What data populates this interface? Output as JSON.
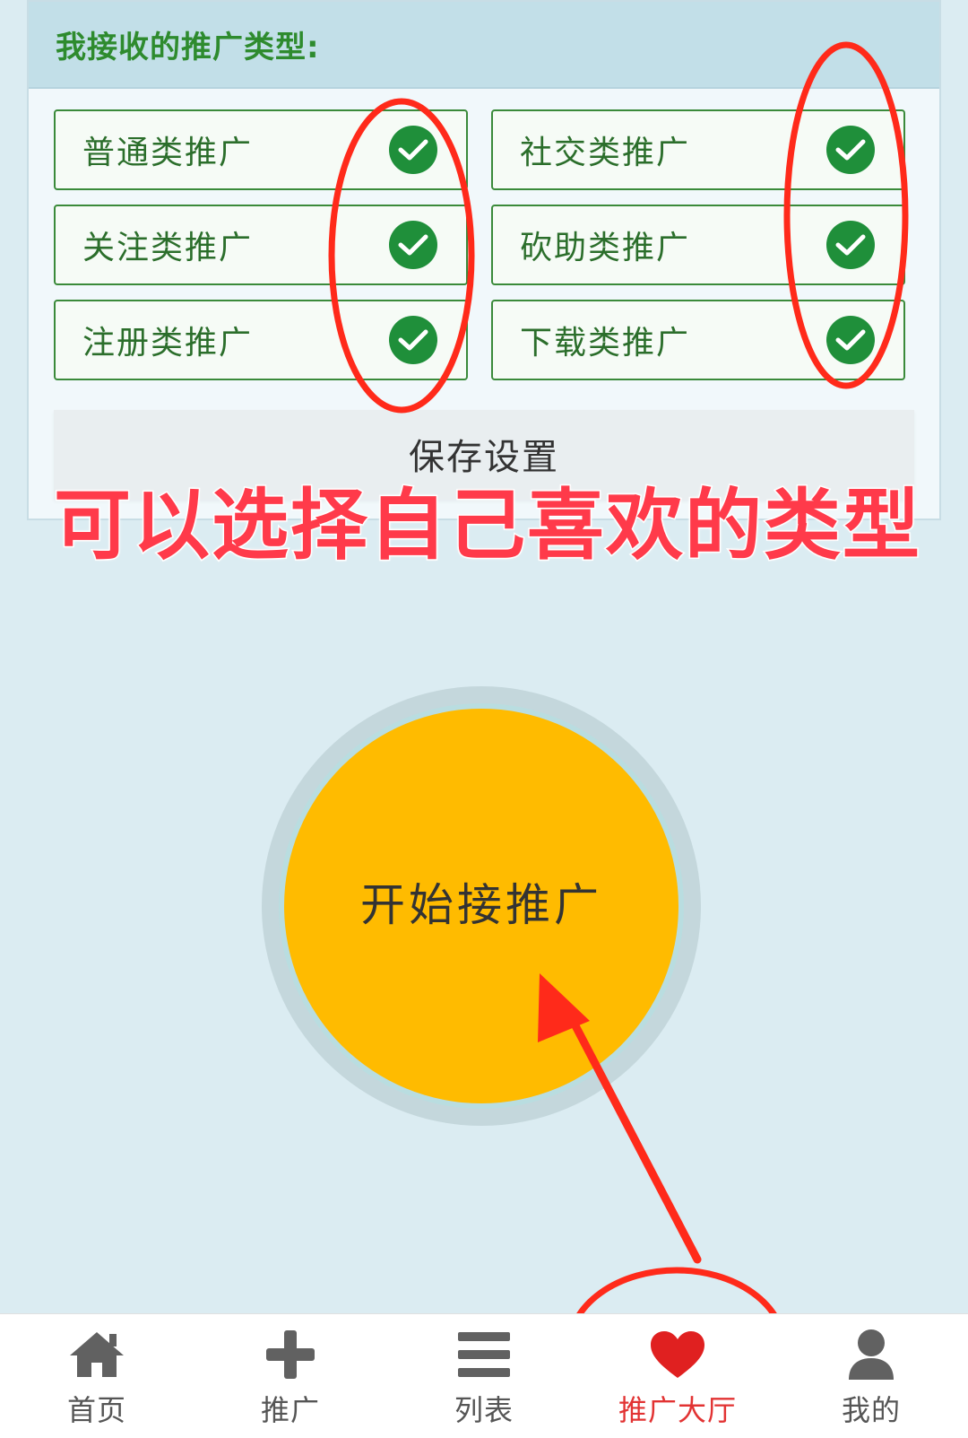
{
  "panel": {
    "title": "我接收的推广类型:",
    "items": [
      {
        "label": "普通类推广",
        "checked": true
      },
      {
        "label": "社交类推广",
        "checked": true
      },
      {
        "label": "关注类推广",
        "checked": true
      },
      {
        "label": "砍助类推广",
        "checked": true
      },
      {
        "label": "注册类推广",
        "checked": true
      },
      {
        "label": "下载类推广",
        "checked": true
      }
    ],
    "save_label": "保存设置"
  },
  "overlay_text": "可以选择自己喜欢的类型",
  "start_button": {
    "label": "开始接推广"
  },
  "tabs": [
    {
      "label": "首页",
      "icon": "home-icon"
    },
    {
      "label": "推广",
      "icon": "plus-icon"
    },
    {
      "label": "列表",
      "icon": "list-icon"
    },
    {
      "label": "推广大厅",
      "icon": "heart-icon",
      "active": true
    },
    {
      "label": "我的",
      "icon": "user-icon"
    }
  ],
  "colors": {
    "accent_green": "#2e8b2e",
    "check_green": "#1f8f3a",
    "start_yellow": "#ffbb00",
    "annotation_red": "#ff3a2a",
    "active_tab": "#e23333"
  }
}
